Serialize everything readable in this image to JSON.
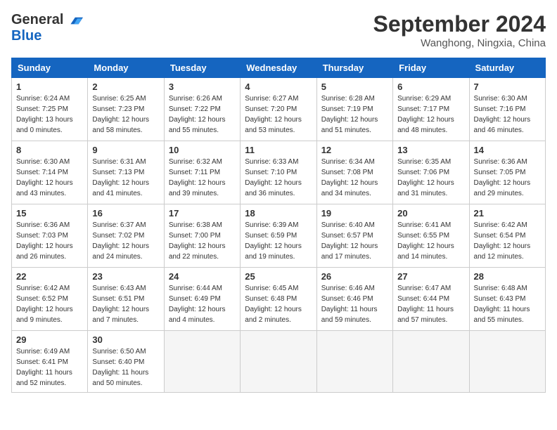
{
  "logo": {
    "general": "General",
    "blue": "Blue"
  },
  "title": "September 2024",
  "location": "Wanghong, Ningxia, China",
  "days_of_week": [
    "Sunday",
    "Monday",
    "Tuesday",
    "Wednesday",
    "Thursday",
    "Friday",
    "Saturday"
  ],
  "weeks": [
    [
      {
        "day": 1,
        "sunrise": "6:24 AM",
        "sunset": "7:25 PM",
        "daylight": "13 hours and 0 minutes."
      },
      {
        "day": 2,
        "sunrise": "6:25 AM",
        "sunset": "7:23 PM",
        "daylight": "12 hours and 58 minutes."
      },
      {
        "day": 3,
        "sunrise": "6:26 AM",
        "sunset": "7:22 PM",
        "daylight": "12 hours and 55 minutes."
      },
      {
        "day": 4,
        "sunrise": "6:27 AM",
        "sunset": "7:20 PM",
        "daylight": "12 hours and 53 minutes."
      },
      {
        "day": 5,
        "sunrise": "6:28 AM",
        "sunset": "7:19 PM",
        "daylight": "12 hours and 51 minutes."
      },
      {
        "day": 6,
        "sunrise": "6:29 AM",
        "sunset": "7:17 PM",
        "daylight": "12 hours and 48 minutes."
      },
      {
        "day": 7,
        "sunrise": "6:30 AM",
        "sunset": "7:16 PM",
        "daylight": "12 hours and 46 minutes."
      }
    ],
    [
      {
        "day": 8,
        "sunrise": "6:30 AM",
        "sunset": "7:14 PM",
        "daylight": "12 hours and 43 minutes."
      },
      {
        "day": 9,
        "sunrise": "6:31 AM",
        "sunset": "7:13 PM",
        "daylight": "12 hours and 41 minutes."
      },
      {
        "day": 10,
        "sunrise": "6:32 AM",
        "sunset": "7:11 PM",
        "daylight": "12 hours and 39 minutes."
      },
      {
        "day": 11,
        "sunrise": "6:33 AM",
        "sunset": "7:10 PM",
        "daylight": "12 hours and 36 minutes."
      },
      {
        "day": 12,
        "sunrise": "6:34 AM",
        "sunset": "7:08 PM",
        "daylight": "12 hours and 34 minutes."
      },
      {
        "day": 13,
        "sunrise": "6:35 AM",
        "sunset": "7:06 PM",
        "daylight": "12 hours and 31 minutes."
      },
      {
        "day": 14,
        "sunrise": "6:36 AM",
        "sunset": "7:05 PM",
        "daylight": "12 hours and 29 minutes."
      }
    ],
    [
      {
        "day": 15,
        "sunrise": "6:36 AM",
        "sunset": "7:03 PM",
        "daylight": "12 hours and 26 minutes."
      },
      {
        "day": 16,
        "sunrise": "6:37 AM",
        "sunset": "7:02 PM",
        "daylight": "12 hours and 24 minutes."
      },
      {
        "day": 17,
        "sunrise": "6:38 AM",
        "sunset": "7:00 PM",
        "daylight": "12 hours and 22 minutes."
      },
      {
        "day": 18,
        "sunrise": "6:39 AM",
        "sunset": "6:59 PM",
        "daylight": "12 hours and 19 minutes."
      },
      {
        "day": 19,
        "sunrise": "6:40 AM",
        "sunset": "6:57 PM",
        "daylight": "12 hours and 17 minutes."
      },
      {
        "day": 20,
        "sunrise": "6:41 AM",
        "sunset": "6:55 PM",
        "daylight": "12 hours and 14 minutes."
      },
      {
        "day": 21,
        "sunrise": "6:42 AM",
        "sunset": "6:54 PM",
        "daylight": "12 hours and 12 minutes."
      }
    ],
    [
      {
        "day": 22,
        "sunrise": "6:42 AM",
        "sunset": "6:52 PM",
        "daylight": "12 hours and 9 minutes."
      },
      {
        "day": 23,
        "sunrise": "6:43 AM",
        "sunset": "6:51 PM",
        "daylight": "12 hours and 7 minutes."
      },
      {
        "day": 24,
        "sunrise": "6:44 AM",
        "sunset": "6:49 PM",
        "daylight": "12 hours and 4 minutes."
      },
      {
        "day": 25,
        "sunrise": "6:45 AM",
        "sunset": "6:48 PM",
        "daylight": "12 hours and 2 minutes."
      },
      {
        "day": 26,
        "sunrise": "6:46 AM",
        "sunset": "6:46 PM",
        "daylight": "11 hours and 59 minutes."
      },
      {
        "day": 27,
        "sunrise": "6:47 AM",
        "sunset": "6:44 PM",
        "daylight": "11 hours and 57 minutes."
      },
      {
        "day": 28,
        "sunrise": "6:48 AM",
        "sunset": "6:43 PM",
        "daylight": "11 hours and 55 minutes."
      }
    ],
    [
      {
        "day": 29,
        "sunrise": "6:49 AM",
        "sunset": "6:41 PM",
        "daylight": "11 hours and 52 minutes."
      },
      {
        "day": 30,
        "sunrise": "6:50 AM",
        "sunset": "6:40 PM",
        "daylight": "11 hours and 50 minutes."
      },
      null,
      null,
      null,
      null,
      null
    ]
  ]
}
